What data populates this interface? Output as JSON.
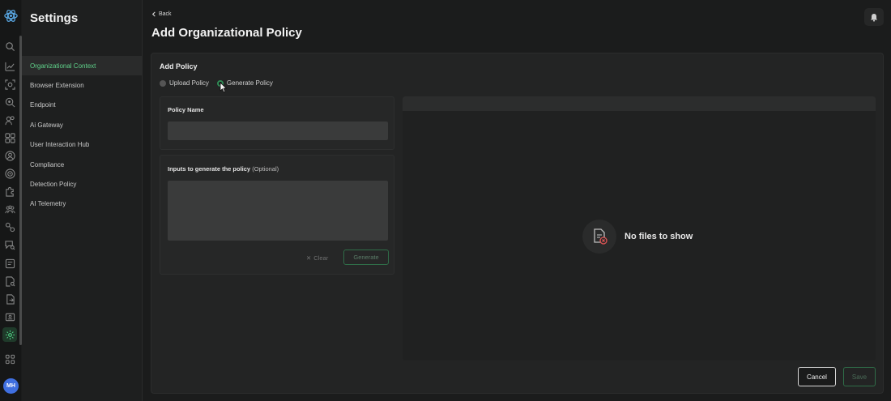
{
  "app": {
    "avatar_initials": "MH",
    "accent_color": "#5fd28a",
    "rail_icons": [
      "search-icon",
      "analytics-icon",
      "scan-icon",
      "inspect-icon",
      "users-icon",
      "apps-grid-icon",
      "profile-icon",
      "target-icon",
      "puzzle-icon",
      "team-icon",
      "link-icon",
      "chat-search-icon",
      "report-icon",
      "document-search-icon",
      "file-export-icon",
      "id-card-icon",
      "settings-icon",
      "launcher-grid-icon"
    ]
  },
  "sidebar": {
    "title": "Settings",
    "items": [
      {
        "label": "Organizational Context",
        "active": true
      },
      {
        "label": "Browser Extension",
        "active": false
      },
      {
        "label": "Endpoint",
        "active": false
      },
      {
        "label": "Ai Gateway",
        "active": false
      },
      {
        "label": "User Interaction Hub",
        "active": false
      },
      {
        "label": "Compliance",
        "active": false
      },
      {
        "label": "Detection Policy",
        "active": false
      },
      {
        "label": "AI Telemetry",
        "active": false
      }
    ]
  },
  "header": {
    "back_label": "Back",
    "title": "Add Organizational Policy"
  },
  "form": {
    "card_title": "Add Policy",
    "mode_options": [
      {
        "label": "Upload Policy",
        "checked": false
      },
      {
        "label": "Generate Policy",
        "checked": true
      }
    ],
    "policy_name_label": "Policy Name",
    "policy_name_value": "",
    "inputs_label": "Inputs to generate the policy",
    "inputs_optional": "(Optional)",
    "inputs_value": "",
    "clear_label": "Clear",
    "generate_label": "Generate"
  },
  "preview": {
    "empty_text": "No files to show"
  },
  "footer": {
    "cancel_label": "Cancel",
    "save_label": "Save"
  }
}
